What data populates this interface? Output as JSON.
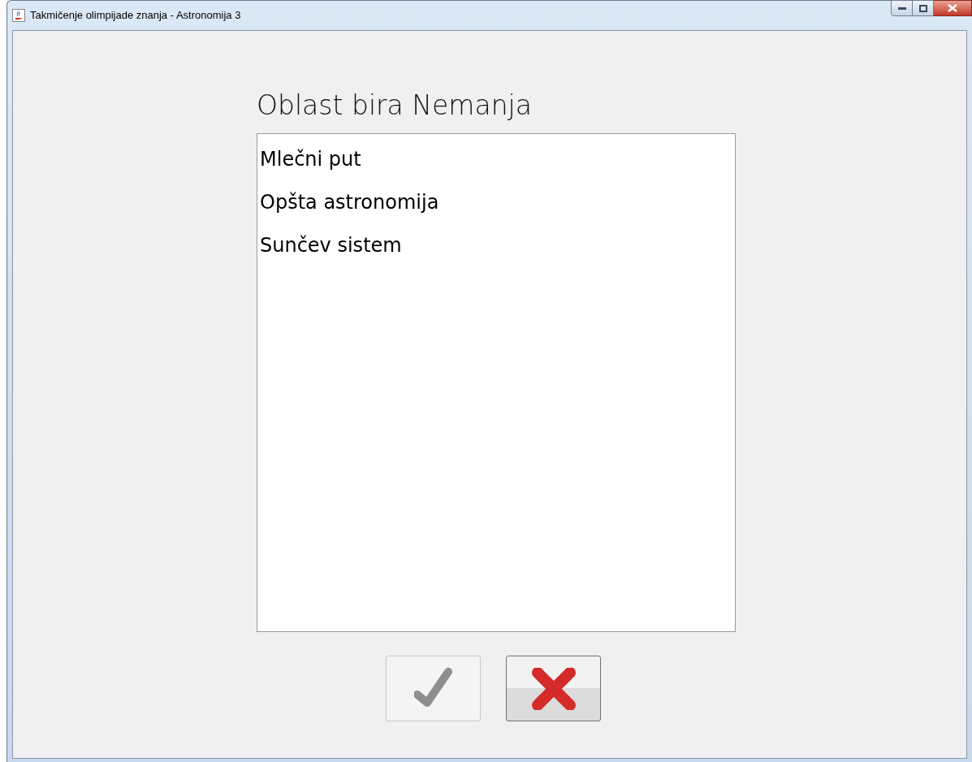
{
  "window": {
    "title": "Takmičenje olimpijade znanja - Astronomija 3"
  },
  "heading": "Oblast bira Nemanja",
  "list": {
    "items": [
      "Mlečni put",
      "Opšta astronomija",
      "Sunčev sistem"
    ]
  },
  "buttons": [
    {
      "kind": "confirm",
      "disabled": true
    },
    {
      "kind": "cancel",
      "disabled": false
    }
  ]
}
